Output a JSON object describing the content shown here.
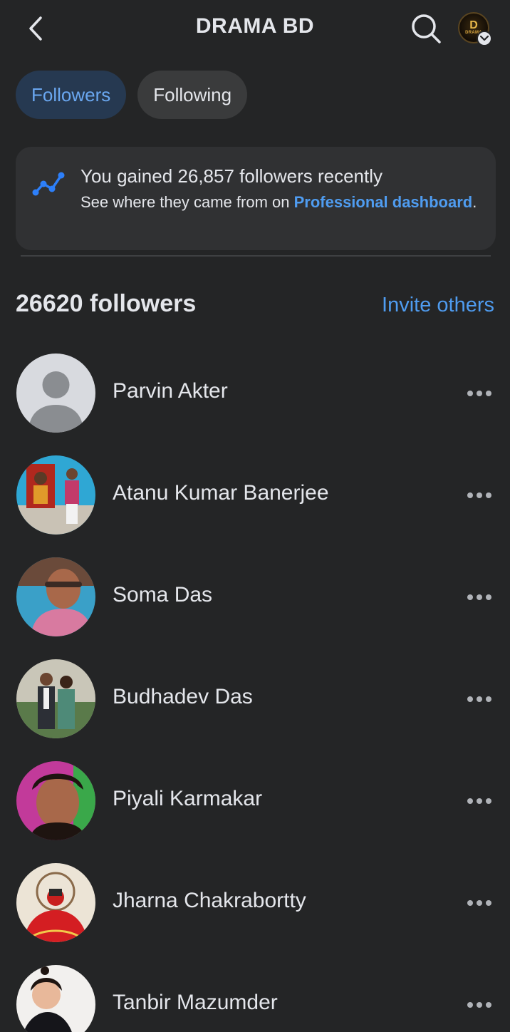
{
  "header": {
    "title": "DRAMA BD",
    "back_icon": "chevron-left-icon",
    "search_icon": "search-icon",
    "page_logo_text": "D",
    "page_logo_subtext": "DRAMA"
  },
  "tabs": [
    {
      "label": "Followers",
      "active": true
    },
    {
      "label": "Following",
      "active": false
    }
  ],
  "gain_card": {
    "title": "You gained 26,857 followers recently",
    "subtitle_prefix": "See where they came from on ",
    "link": "Professional dashboard",
    "subtitle_suffix": ".",
    "icon": "trending-chart-icon"
  },
  "followers_section": {
    "count_label": "26620 followers",
    "invite_label": "Invite others"
  },
  "followers": [
    {
      "name": "Parvin Akter"
    },
    {
      "name": "Atanu Kumar Banerjee"
    },
    {
      "name": "Soma Das"
    },
    {
      "name": "Budhadev Das"
    },
    {
      "name": "Piyali Karmakar"
    },
    {
      "name": "Jharna Chakrabortty"
    },
    {
      "name": "Tanbir Mazumder"
    }
  ],
  "colors": {
    "background": "#242526",
    "accent": "#4f9cf0",
    "active_tab_bg": "#263951",
    "card_bg": "#303133"
  }
}
